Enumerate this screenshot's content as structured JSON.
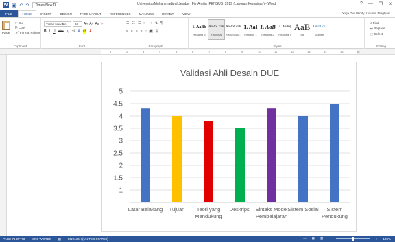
{
  "window": {
    "app_logo": "W",
    "font_mini": "Times New R",
    "title": "UniversitasMuhammadiyahJember_FitriAmilia_PENSUS_2019 (Laporan Kemajuan) - Word",
    "help": "?",
    "minimize": "—",
    "restore": "❐",
    "close": "✕"
  },
  "tabs": [
    "FILE",
    "HOME",
    "INSERT",
    "DESIGN",
    "PAGE LAYOUT",
    "REFERENCES",
    "MAILINGS",
    "REVIEW",
    "VIEW"
  ],
  "user": "Yoga Dwi Windy Kusuma Ningtyas",
  "clipboard": {
    "paste": "Paste",
    "cut": "Cut",
    "copy": "Copy",
    "format_painter": "Format Painter",
    "label": "Clipboard"
  },
  "font": {
    "name": "Times New Ro",
    "size": "10",
    "label": "Font",
    "bold": "B",
    "italic": "I",
    "underline": "U",
    "strike": "abc",
    "sub": "x₂",
    "sup": "x²"
  },
  "paragraph": {
    "label": "Paragraph"
  },
  "styles": {
    "label": "Styles",
    "items": [
      {
        "preview": "1. AaBb",
        "name": "Heading 6"
      },
      {
        "preview": "AaBbCcDc",
        "name": "¶ Normal"
      },
      {
        "preview": "AaBbCcDc",
        "name": "¶ No Spac..."
      },
      {
        "preview": "1. AaI",
        "name": "Heading 1"
      },
      {
        "preview": "1. AaB",
        "name": "Heading 2"
      },
      {
        "preview": "1. AaBb(",
        "name": "Heading 7"
      },
      {
        "preview": "AaB",
        "name": "Title"
      },
      {
        "preview": "AaBbCcC",
        "name": "Subtitle"
      }
    ]
  },
  "editing": {
    "find": "Find",
    "replace": "Replace",
    "select": "Select",
    "label": "Editing"
  },
  "ruler_ticks": [
    "1",
    "2",
    "3",
    "4",
    "5",
    "6",
    "7",
    "8",
    "9",
    "10",
    "11",
    "12",
    "13",
    "14",
    "15",
    "16"
  ],
  "status": {
    "page": "PAGE 71 OF 73",
    "words": "8090 WORDS",
    "lang": "ENGLISH (UNITED STATES)",
    "zoom": "100%"
  },
  "chart_data": {
    "type": "bar",
    "title": "Validasi Ahli Desain DUE",
    "categories": [
      [
        "Latar Belakang"
      ],
      [
        "Tujuan"
      ],
      [
        "Teori yang",
        "Mendukung"
      ],
      [
        "Deskripsi"
      ],
      [
        "Sintaks Model",
        "Pembelajaran"
      ],
      [
        "Sistem Sosial"
      ],
      [
        "Sistem",
        "Pendukung"
      ]
    ],
    "values": [
      4.3,
      4.0,
      3.8,
      3.5,
      4.3,
      4.0,
      4.5
    ],
    "colors": [
      "#4472c4",
      "#ffc000",
      "#e00000",
      "#00b050",
      "#7030a0",
      "#4472c4",
      "#4472c4"
    ],
    "yticks": [
      "1",
      "1.5",
      "2",
      "2.5",
      "3",
      "3.5",
      "4",
      "4.5",
      "5"
    ],
    "ylim": [
      0.5,
      5.0
    ],
    "grid": true
  }
}
